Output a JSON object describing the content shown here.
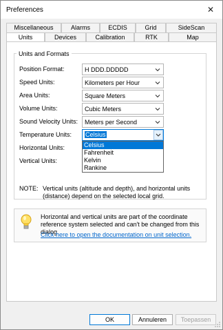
{
  "window": {
    "title": "Preferences",
    "close_glyph": "✕"
  },
  "tabs_back": [
    {
      "label": "Miscellaneous",
      "w": 80
    },
    {
      "label": "Alarms",
      "w": 56
    },
    {
      "label": "ECDIS",
      "w": 52
    },
    {
      "label": "Grid",
      "w": 44
    },
    {
      "label": "SideScan",
      "w": 74
    }
  ],
  "tabs_front": [
    {
      "label": "Units",
      "w": 56,
      "active": true
    },
    {
      "label": "Devices",
      "w": 60
    },
    {
      "label": "Calibration",
      "w": 70
    },
    {
      "label": "RTK",
      "w": 50
    },
    {
      "label": "Map",
      "w": 70
    }
  ],
  "units_group": {
    "title": "Units and Formats",
    "rows": [
      {
        "label": "Position Format:",
        "value": "H DDD.DDDDD"
      },
      {
        "label": "Speed Units:",
        "value": "Kilometers per Hour"
      },
      {
        "label": "Area Units:",
        "value": "Square Meters"
      },
      {
        "label": "Volume Units:",
        "value": "Cubic Meters"
      },
      {
        "label": "Sound Velocity Units:",
        "value": "Meters per Second"
      },
      {
        "label": "Temperature Units:",
        "value": "Celsius",
        "open": true
      },
      {
        "label": "Horizontal Units:",
        "value": ""
      },
      {
        "label": "Vertical Units:",
        "value": ""
      }
    ],
    "temperature_options": [
      "Celsius",
      "Fahrenheit",
      "Kelvin",
      "Rankine"
    ],
    "temperature_selected": "Celsius",
    "note_head": "NOTE:",
    "note_body": "Vertical units (altitude and depth), and horizontal units (distance) depend on the selected local grid."
  },
  "info": {
    "icon": "lightbulb-icon",
    "text": "Horizontal and vertical units are part of the coordinate reference system selected and can't be changed from this dialog.",
    "link": "Click here to open the documentation on unit selection."
  },
  "buttons": {
    "ok": "OK",
    "cancel": "Annuleren",
    "apply": "Toepassen"
  },
  "colors": {
    "accent": "#0078d7",
    "link": "#0066cc"
  }
}
